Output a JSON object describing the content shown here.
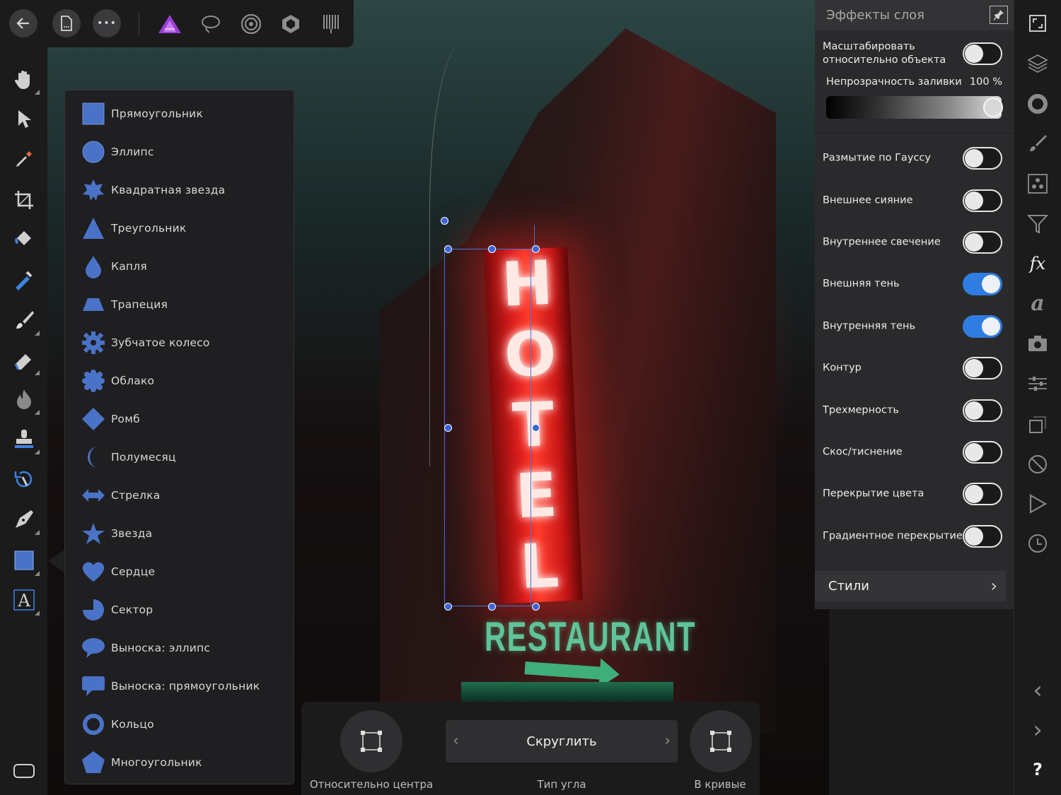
{
  "top_bar": {
    "back": "←",
    "document": "document-icon",
    "more": "•••",
    "personas": [
      "designer-persona-icon",
      "lasso-icon",
      "liquify-icon",
      "develop-icon",
      "export-icon"
    ]
  },
  "tools": [
    "hand-tool",
    "move-tool",
    "color-picker-tool",
    "crop-tool",
    "fill-tool",
    "transparency-tool",
    "brush-tool",
    "eraser-tool",
    "burn-tool",
    "clone-tool",
    "undo-brush-tool",
    "pen-tool",
    "rectangle-tool",
    "text-tool",
    "selection-shape-tool"
  ],
  "shape_menu": {
    "items": [
      {
        "label": "Прямоугольник",
        "icon": "rectangle-shape-icon"
      },
      {
        "label": "Эллипс",
        "icon": "ellipse-shape-icon"
      },
      {
        "label": "Квадратная звезда",
        "icon": "square-star-shape-icon"
      },
      {
        "label": "Треугольник",
        "icon": "triangle-shape-icon"
      },
      {
        "label": "Капля",
        "icon": "teardrop-shape-icon"
      },
      {
        "label": "Трапеция",
        "icon": "trapezoid-shape-icon"
      },
      {
        "label": "Зубчатое колесо",
        "icon": "cog-shape-icon"
      },
      {
        "label": "Облако",
        "icon": "cloud-shape-icon"
      },
      {
        "label": "Ромб",
        "icon": "diamond-shape-icon"
      },
      {
        "label": "Полумесяц",
        "icon": "crescent-shape-icon"
      },
      {
        "label": "Стрелка",
        "icon": "arrow-shape-icon"
      },
      {
        "label": "Звезда",
        "icon": "star-shape-icon"
      },
      {
        "label": "Сердце",
        "icon": "heart-shape-icon"
      },
      {
        "label": "Сектор",
        "icon": "pie-shape-icon"
      },
      {
        "label": "Выноска: эллипс",
        "icon": "callout-ellipse-shape-icon"
      },
      {
        "label": "Выноска: прямоугольник",
        "icon": "callout-rectangle-shape-icon"
      },
      {
        "label": "Кольцо",
        "icon": "donut-shape-icon"
      },
      {
        "label": "Многоугольник",
        "icon": "polygon-shape-icon"
      }
    ]
  },
  "canvas": {
    "sign_letters": [
      "H",
      "O",
      "T",
      "E",
      "L"
    ],
    "restaurant_text": "RESTAURANT"
  },
  "context_bar": {
    "relative_center_label": "Относительно центра",
    "corner_type_label": "Тип угла",
    "corner_type_value": "Скруглить",
    "to_curves_label": "В кривые"
  },
  "fx_panel": {
    "title": "Эффекты слоя",
    "scale_label": "Масштабировать относительно объекта",
    "scale_on": false,
    "opacity_label": "Непрозрачность заливки",
    "opacity_value": "100 %",
    "opacity_fraction": 1.0,
    "effects": [
      {
        "label": "Размытие по Гауссу",
        "on": false
      },
      {
        "label": "Внешнее сияние",
        "on": false
      },
      {
        "label": "Внутреннее свечение",
        "on": false
      },
      {
        "label": "Внешняя тень",
        "on": true
      },
      {
        "label": "Внутренняя тень",
        "on": true
      },
      {
        "label": "Контур",
        "on": false
      },
      {
        "label": "Трехмерность",
        "on": false
      },
      {
        "label": "Скос/тиснение",
        "on": false
      },
      {
        "label": "Перекрытие цвета",
        "on": false
      },
      {
        "label": "Градиентное перекрытие",
        "on": false
      }
    ],
    "styles_label": "Стили"
  },
  "studios": [
    "navigator-icon",
    "layers-icon",
    "color-icon",
    "brushes-icon",
    "swatches-icon",
    "adjustments-icon",
    "fx-icon",
    "text-styles-icon",
    "camera-icon",
    "channels-icon",
    "transform-icon",
    "history-forbidden-icon",
    "macros-icon",
    "history-icon"
  ],
  "bottom_right": {
    "prev": "‹",
    "next": "›",
    "help": "?"
  },
  "colors": {
    "accent": "#2f7de0",
    "selection": "#4b6fd8",
    "shape_icon": "#4a73c7"
  }
}
